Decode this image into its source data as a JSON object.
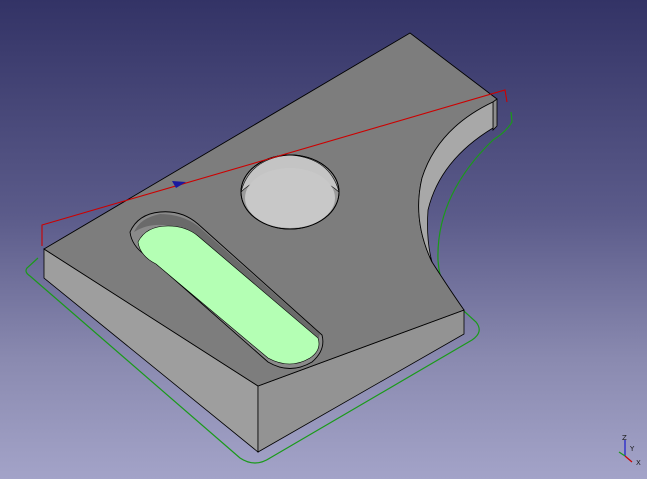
{
  "view": {
    "background_top": "#333366",
    "background_bottom": "#a3a3c8"
  },
  "part": {
    "top_face_color": "#7d7d7d",
    "side_face_color": "#9e9e9e",
    "edge_color": "#000000",
    "selected_face_color": "#b4ffb4"
  },
  "toolpath": {
    "profile_color": "#1a9a1a",
    "rapid_color": "#cc0000",
    "direction_marker_color": "#1a1aa0"
  },
  "axis_indicator": {
    "z_label": "Z",
    "y_label": "Y",
    "x_label": "X",
    "x_color": "#cc0000",
    "y_color": "#1a9a1a",
    "z_color": "#1a1acc"
  }
}
